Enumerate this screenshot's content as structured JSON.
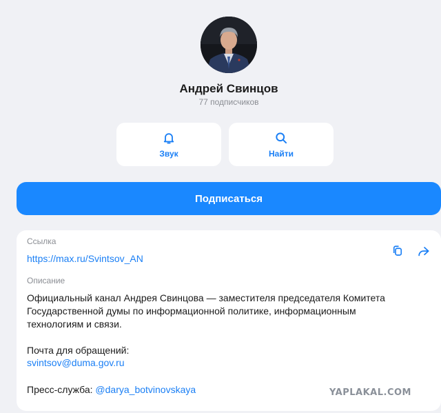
{
  "channel": {
    "name": "Андрей Свинцов",
    "subscribers": "77 подписчиков"
  },
  "actions": [
    {
      "label": "Звук",
      "icon": "bell-icon"
    },
    {
      "label": "Найти",
      "icon": "search-icon"
    }
  ],
  "subscribe_label": "Подписаться",
  "info": {
    "link_label": "Ссылка",
    "link": "https://max.ru/Svintsov_AN",
    "description_label": "Описание",
    "description_lines": [
      "Официальный канал Андрея Свинцова — заместителя председателя Комитета",
      "Государственной думы по информационной политике, информационным",
      "технологиям и связи."
    ],
    "mail_label": "Почта для обращений:",
    "mail": "svintsov@duma.gov.ru",
    "press_label": "Пресс-служба:",
    "press_handle": "@darya_botvinovskaya"
  },
  "watermark": "YAPLAKAL.COM",
  "colors": {
    "accent": "#1a88ff",
    "link": "#1a7ff5",
    "background": "#f0f1f5",
    "muted": "#8a8d93"
  }
}
